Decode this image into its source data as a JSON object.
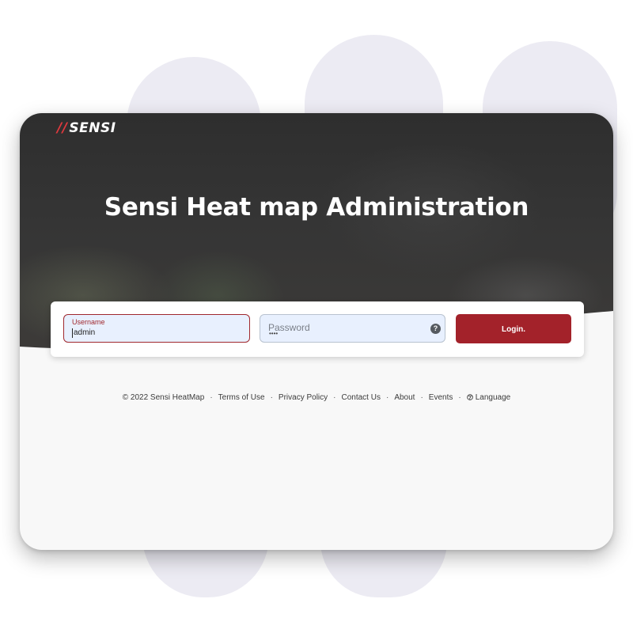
{
  "app": {
    "logo_text": "SENSI",
    "logo_mark": "//",
    "title": "Sensi Heat map Administration"
  },
  "login": {
    "username_label": "Username",
    "username_value": "admin",
    "password_placeholder": "Password",
    "password_mask": "••••",
    "help_icon": "question-circle-icon",
    "button_label": "Login."
  },
  "footer": {
    "copyright": "© 2022 Sensi HeatMap",
    "links": [
      "Terms of Use",
      "Privacy Policy",
      "Contact Us",
      "About",
      "Events",
      "Language"
    ],
    "separator": "·",
    "language_icon": "globe-icon"
  },
  "colors": {
    "brand_red": "#a3222a",
    "logo_accent": "#e0393e",
    "field_bg": "#e8f0fe",
    "page_bg": "#f8f8f8"
  }
}
